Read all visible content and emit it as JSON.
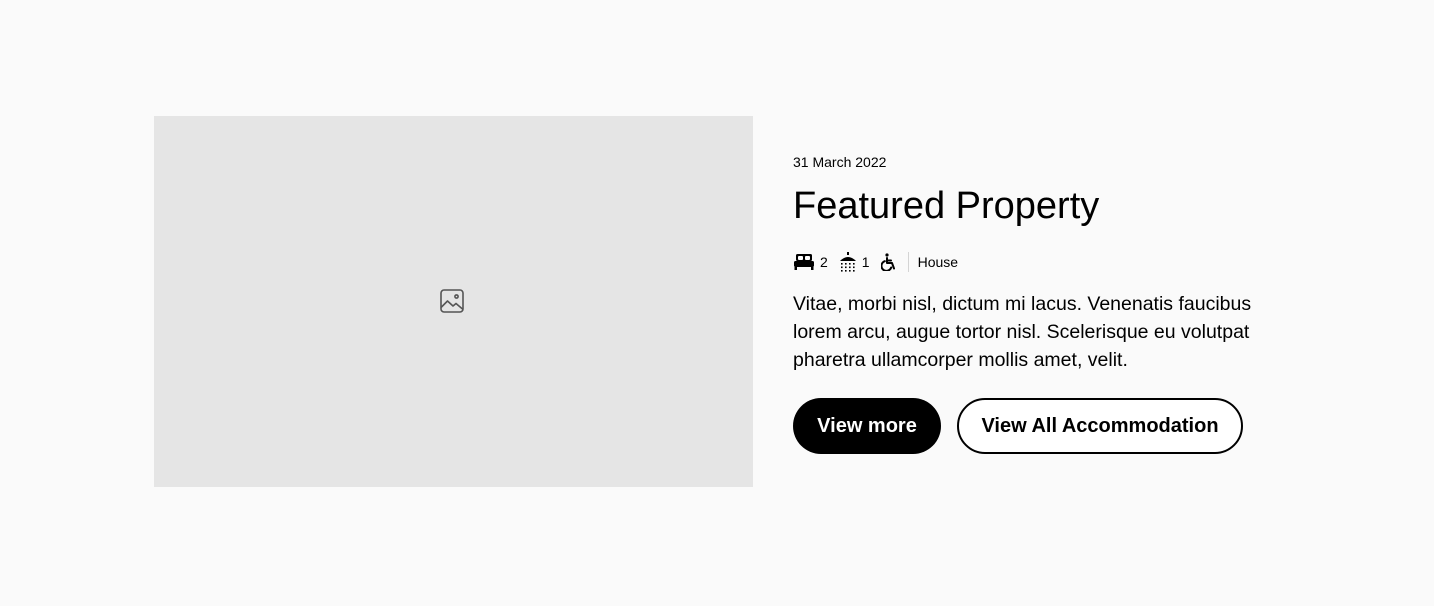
{
  "property": {
    "date": "31 March 2022",
    "title": "Featured Property",
    "bedrooms": "2",
    "bathrooms": "1",
    "type": "House",
    "description": "Vitae, morbi nisl, dictum mi lacus. Venenatis faucibus lorem arcu, augue tortor nisl. Scelerisque eu volutpat pharetra ullamcorper mollis amet, velit."
  },
  "actions": {
    "view_more": "View more",
    "view_all": "View All Accommodation"
  },
  "icons": {
    "image_placeholder": "image-icon",
    "bedrooms": "bed-icon",
    "bathrooms": "shower-icon",
    "accessibility": "wheelchair-icon"
  },
  "colors": {
    "background": "#fafafa",
    "image_placeholder": "#e5e5e5",
    "primary_button": "#000000",
    "text": "#000000"
  }
}
